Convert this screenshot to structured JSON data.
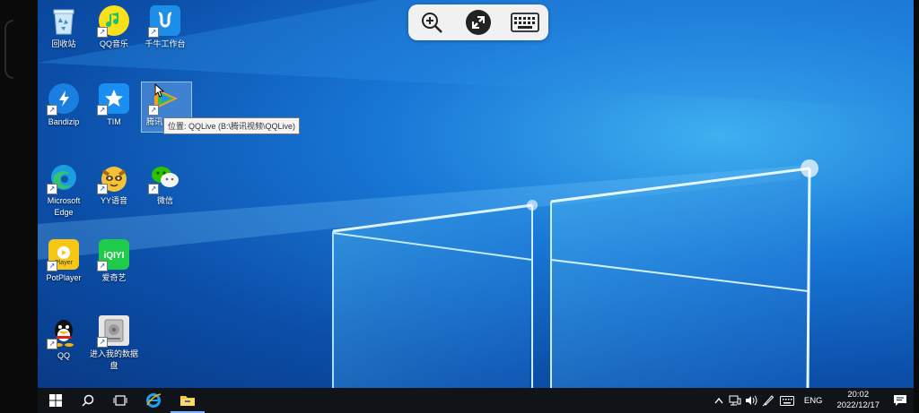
{
  "desktop": {
    "icons": [
      {
        "label": "回收站",
        "icon": "recycle-bin-icon",
        "shortcut": false
      },
      {
        "label": "QQ音乐",
        "icon": "qq-music-icon",
        "shortcut": true
      },
      {
        "label": "千牛工作台",
        "icon": "qianniu-icon",
        "shortcut": true
      },
      {
        "label": "Bandizip",
        "icon": "bandizip-icon",
        "shortcut": true
      },
      {
        "label": "TIM",
        "icon": "tim-icon",
        "shortcut": true
      },
      {
        "label": "腾讯",
        "icon": "tencent-video-icon",
        "shortcut": true
      },
      {
        "label": "Microsoft Edge",
        "icon": "edge-icon",
        "shortcut": true
      },
      {
        "label": "YY语音",
        "icon": "yy-icon",
        "shortcut": true
      },
      {
        "label": "微信",
        "icon": "wechat-icon",
        "shortcut": true
      },
      {
        "label": "PotPlayer",
        "icon": "potplayer-icon",
        "shortcut": true
      },
      {
        "label": "爱奇艺",
        "icon": "iqiyi-icon",
        "shortcut": true
      },
      {
        "label": "QQ",
        "icon": "qq-icon",
        "shortcut": true
      },
      {
        "label": "进入我的数据盘",
        "icon": "drive-icon",
        "shortcut": true
      }
    ],
    "tooltip": "位置: QQLive (B:\\腾讯视频\\QQLive)"
  },
  "icon_images": {
    "potplayer_text": "Player",
    "iqiyi_text": "iQIYI"
  },
  "remote_toolbar": {
    "zoom": "zoom-in-icon",
    "remote": "remote-desktop-icon",
    "keyboard": "keyboard-icon"
  },
  "taskbar": {
    "lang": "ENG",
    "time": "20:02",
    "date": "2022/12/17"
  },
  "colors": {
    "accent": "#1877d6",
    "taskbar": "#101418"
  }
}
